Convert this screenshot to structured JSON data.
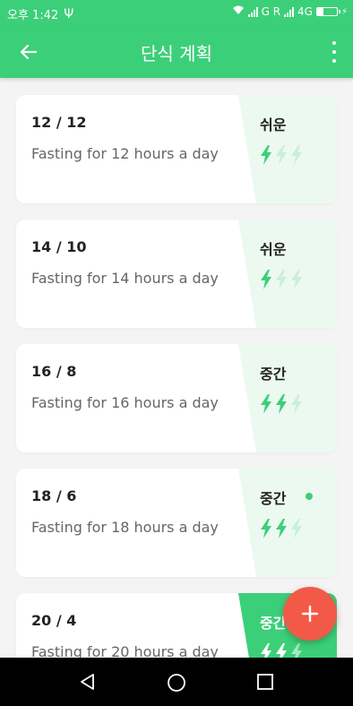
{
  "status_bar": {
    "time": "오후 1:42",
    "carrier1": "G R",
    "network": "4G",
    "battery_level": 0.3
  },
  "app_bar": {
    "title": "단식 계획"
  },
  "plans": [
    {
      "ratio": "12 / 12",
      "desc": "Fasting for 12 hours a day",
      "level": "쉬운",
      "bolts_filled": 1,
      "selected": false
    },
    {
      "ratio": "14 / 10",
      "desc": "Fasting for 14 hours a day",
      "level": "쉬운",
      "bolts_filled": 1,
      "selected": false
    },
    {
      "ratio": "16 / 8",
      "desc": "Fasting for 16 hours a day",
      "level": "중간",
      "bolts_filled": 2,
      "selected": false
    },
    {
      "ratio": "18 / 6",
      "desc": "Fasting for 18 hours a day",
      "level": "중간",
      "bolts_filled": 2,
      "selected": true
    },
    {
      "ratio": "20 / 4",
      "desc": "Fasting for 20 hours a day",
      "level": "중간",
      "bolts_filled": 2,
      "selected": false,
      "highlighted": true
    }
  ],
  "colors": {
    "primary": "#3ccf79",
    "bolt_filled": "#3ccf79",
    "bolt_empty": "#c9f0d9",
    "side_bg": "#ecf9f1",
    "fab": "#f25a47"
  },
  "icons": {
    "back": "arrow-left-icon",
    "more": "more-vert-icon",
    "fab": "plus-icon",
    "nav_back": "triangle-back-icon",
    "nav_home": "circle-home-icon",
    "nav_recent": "square-recent-icon"
  }
}
